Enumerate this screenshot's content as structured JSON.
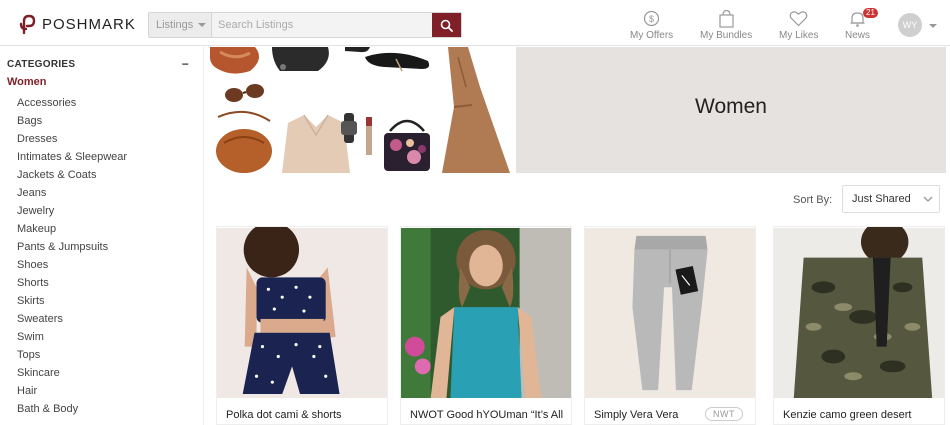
{
  "header": {
    "logo_text": "POSHMARK",
    "search": {
      "category": "Listings",
      "placeholder": "Search Listings"
    },
    "nav": [
      {
        "label": "My Offers",
        "icon": "dollar-circle-icon"
      },
      {
        "label": "My Bundles",
        "icon": "shopping-bag-icon"
      },
      {
        "label": "My Likes",
        "icon": "heart-icon"
      },
      {
        "label": "News",
        "icon": "bell-icon",
        "badge": "21"
      }
    ],
    "avatar_initials": "WY",
    "accent_color": "#7f1f27"
  },
  "sidebar": {
    "heading": "CATEGORIES",
    "collapse_symbol": "−",
    "active": "Women",
    "items": [
      "Accessories",
      "Bags",
      "Dresses",
      "Intimates & Sleepwear",
      "Jackets & Coats",
      "Jeans",
      "Jewelry",
      "Makeup",
      "Pants & Jumpsuits",
      "Shoes",
      "Shorts",
      "Skirts",
      "Sweaters",
      "Swim",
      "Tops",
      "Skincare",
      "Hair",
      "Bath & Body"
    ]
  },
  "banner": {
    "title": "Women"
  },
  "sort": {
    "label": "Sort By:",
    "value": "Just Shared"
  },
  "listings": [
    {
      "title": "Polka dot cami & shorts"
    },
    {
      "title": "NWOT Good hYOUman “It’s All"
    },
    {
      "title": "Simply Vera Vera",
      "tag": "NWT"
    },
    {
      "title": "Kenzie camo green desert"
    }
  ]
}
